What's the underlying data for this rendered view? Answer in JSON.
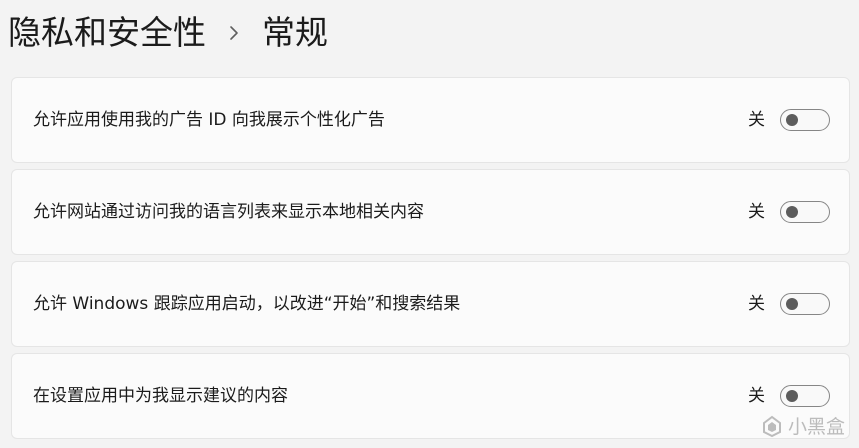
{
  "breadcrumb": {
    "parent": "隐私和安全性",
    "current": "常规"
  },
  "settings": [
    {
      "label": "允许应用使用我的广告 ID 向我展示个性化广告",
      "state_label": "关",
      "on": false
    },
    {
      "label": "允许网站通过访问我的语言列表来显示本地相关内容",
      "state_label": "关",
      "on": false
    },
    {
      "label": "允许 Windows 跟踪应用启动，以改进“开始”和搜索结果",
      "state_label": "关",
      "on": false
    },
    {
      "label": "在设置应用中为我显示建议的内容",
      "state_label": "关",
      "on": false
    }
  ],
  "watermark": {
    "text": "小黑盒",
    "icon": "heybox-logo-icon"
  },
  "colors": {
    "background": "#f3f3f3",
    "card": "#fbfbfb",
    "toggle_knob": "#5d5d5d"
  }
}
